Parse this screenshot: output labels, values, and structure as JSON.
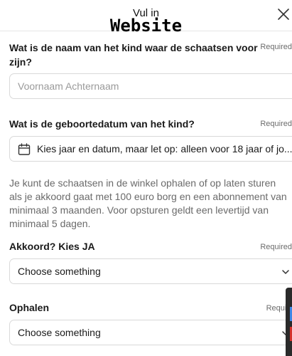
{
  "header": {
    "title": "Vul in",
    "watermark": "Website"
  },
  "fields": [
    {
      "label_line1": "Wat is de naam van het kind waar de schaatsen voor",
      "label_line2": "zijn?",
      "required": "Required",
      "placeholder": "Voornaam Achternaam"
    },
    {
      "label": "Wat is de geboortedatum van het kind?",
      "required": "Required",
      "value": "Kies jaar en datum, maar let op: alleen voor 18 jaar of jo..."
    }
  ],
  "help_text": "Je kunt de schaatsen in de winkel ophalen of op laten sturen als je akkoord gaat met 100 euro borg en een abonnement van minimaal 3 maanden. Voor opsturen geldt een levertijd van minimaal 5 dagen.",
  "selects": [
    {
      "label": "Akkoord? Kies JA",
      "required": "Required",
      "placeholder": "Choose something"
    },
    {
      "label": "Ophalen",
      "required": "Requir",
      "placeholder": "Choose something"
    }
  ],
  "icons": {
    "close": "close-icon",
    "calendar": "calendar-icon",
    "chevron": "chevron-down-icon"
  }
}
